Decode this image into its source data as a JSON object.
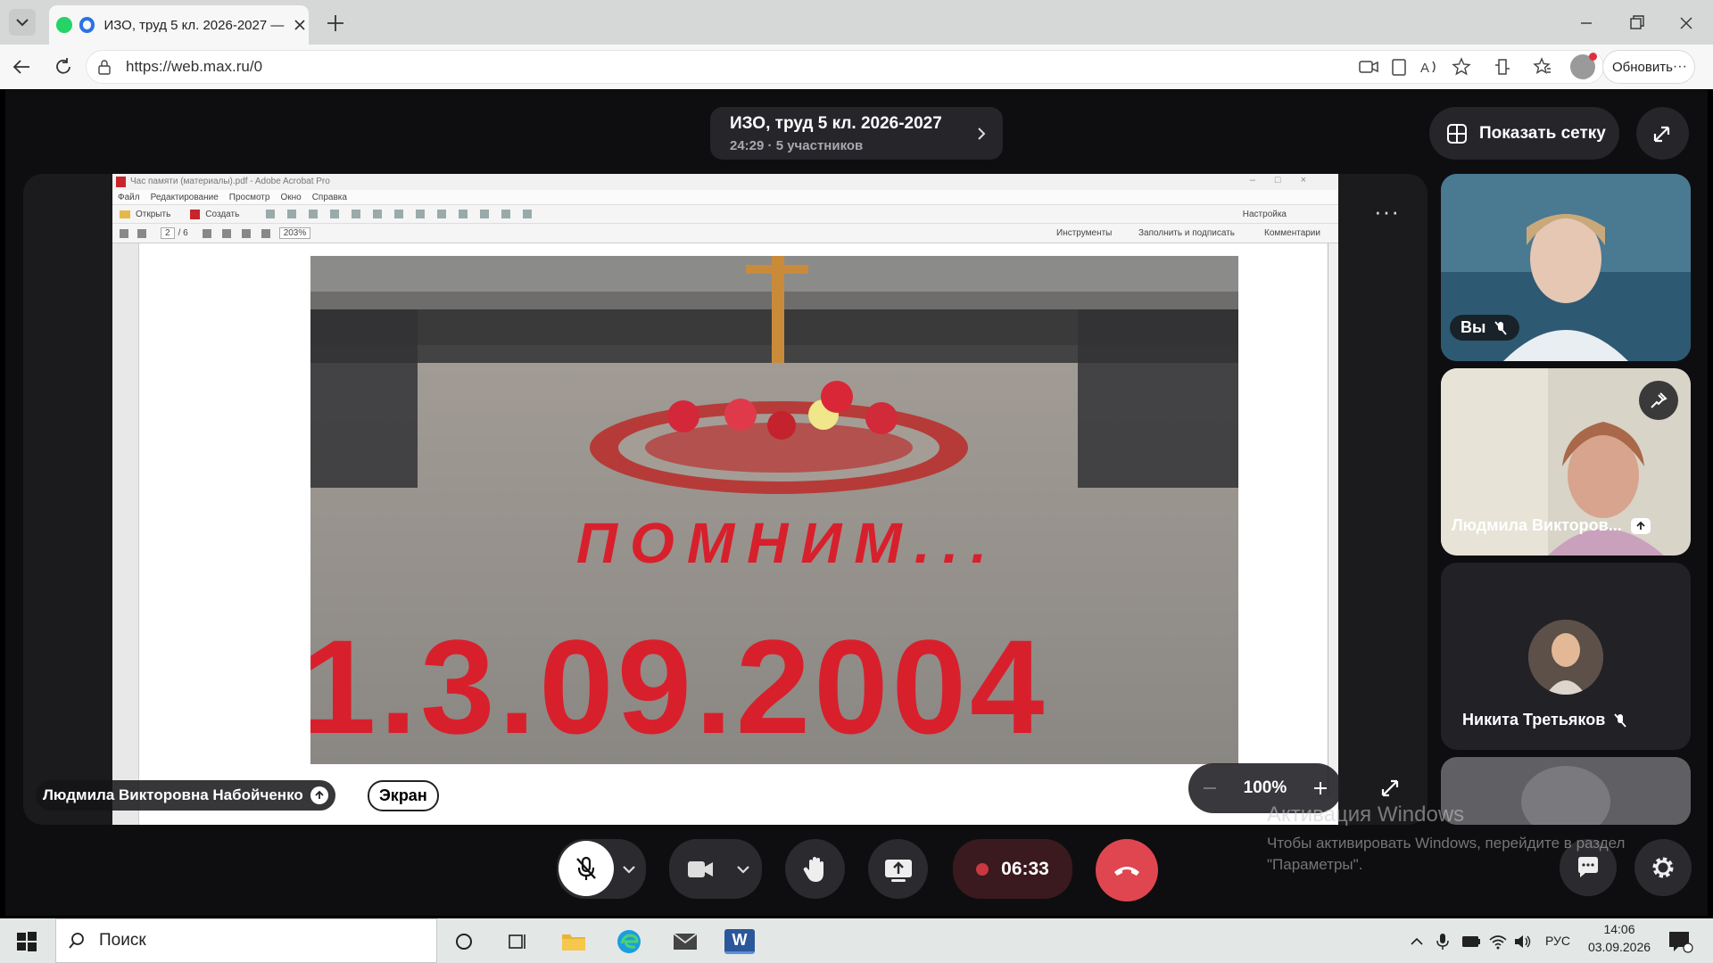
{
  "browser": {
    "tab_title": "ИЗО, труд 5 кл. 2026-2027 —",
    "url": "https://web.max.ru/0",
    "refresh_label": "Обновить"
  },
  "call": {
    "title": "ИЗО, труд 5 кл. 2026-2027",
    "subtitle": "24:29 · 5 участников",
    "grid_label": "Показать сетку",
    "timer": "06:33"
  },
  "acrobat": {
    "window_title": "Час памяти (материалы).pdf - Adobe Acrobat Pro",
    "menu": [
      "Файл",
      "Редактирование",
      "Просмотр",
      "Окно",
      "Справка"
    ],
    "open_label": "Открыть",
    "create_label": "Создать",
    "settings_label": "Настройка",
    "page_current": "2",
    "page_total": "/ 6",
    "zoom": "203%",
    "panel_tools": "Инструменты",
    "panel_fill": "Заполнить и подписать",
    "panel_comments": "Комментарии"
  },
  "photo": {
    "word": "ПОМНИМ...",
    "date": "1.3.09.2004"
  },
  "stage": {
    "zoom_level": "100%",
    "presenter_name": "Людмила Викторовна Набойченко",
    "screen_label": "Экран",
    "camera_label": "Камера"
  },
  "participants": [
    {
      "name": "Вы"
    },
    {
      "name": "Людмила Викторов..."
    },
    {
      "name": "Никита Третьяков"
    }
  ],
  "watermark": {
    "title": "Активация Windows",
    "line1": "Чтобы активировать Windows, перейдите в раздел",
    "line2": "\"Параметры\"."
  },
  "taskbar": {
    "search_placeholder": "Поиск",
    "lang": "РУС",
    "time": "14:06",
    "date": "03.09.2026"
  },
  "colors": {
    "app_bg": "#0e0e10",
    "pill_bg": "#25252a",
    "end_call_red": "#e0464f",
    "timer_bg": "#4a1c22"
  }
}
